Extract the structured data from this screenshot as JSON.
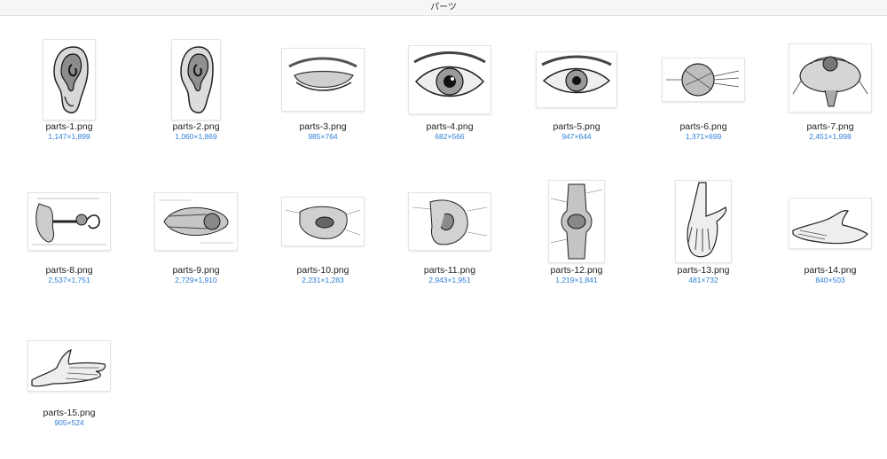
{
  "window": {
    "title": "パーツ"
  },
  "colors": {
    "dims_text": "#2f7fd6",
    "name_text": "#222222",
    "titlebar_bg": "#f6f6f6"
  },
  "files": [
    {
      "name": "parts-1.png",
      "dims": "1,147×1,899",
      "icon": "ear-icon"
    },
    {
      "name": "parts-2.png",
      "dims": "1,060×1,869",
      "icon": "ear-icon"
    },
    {
      "name": "parts-3.png",
      "dims": "985×764",
      "icon": "closed-eye-icon"
    },
    {
      "name": "parts-4.png",
      "dims": "682×566",
      "icon": "eye-icon"
    },
    {
      "name": "parts-5.png",
      "dims": "947×644",
      "icon": "eye-icon"
    },
    {
      "name": "parts-6.png",
      "dims": "1,371×699",
      "icon": "eyeball-diagram-icon"
    },
    {
      "name": "parts-7.png",
      "dims": "2,451×1,998",
      "icon": "eyeball-dissection-icon"
    },
    {
      "name": "parts-8.png",
      "dims": "2,537×1,751",
      "icon": "inner-ear-diagram-icon"
    },
    {
      "name": "parts-9.png",
      "dims": "2,729×1,910",
      "icon": "eye-muscles-diagram-icon"
    },
    {
      "name": "parts-10.png",
      "dims": "2,231×1,283",
      "icon": "eye-socket-diagram-icon"
    },
    {
      "name": "parts-11.png",
      "dims": "2,943×1,951",
      "icon": "head-section-diagram-icon"
    },
    {
      "name": "parts-12.png",
      "dims": "1,219×1,841",
      "icon": "knee-joint-diagram-icon"
    },
    {
      "name": "parts-13.png",
      "dims": "481×732",
      "icon": "hand-icon"
    },
    {
      "name": "parts-14.png",
      "dims": "840×503",
      "icon": "open-hand-icon"
    },
    {
      "name": "parts-15.png",
      "dims": "905×524",
      "icon": "hand-pointing-icon"
    }
  ]
}
